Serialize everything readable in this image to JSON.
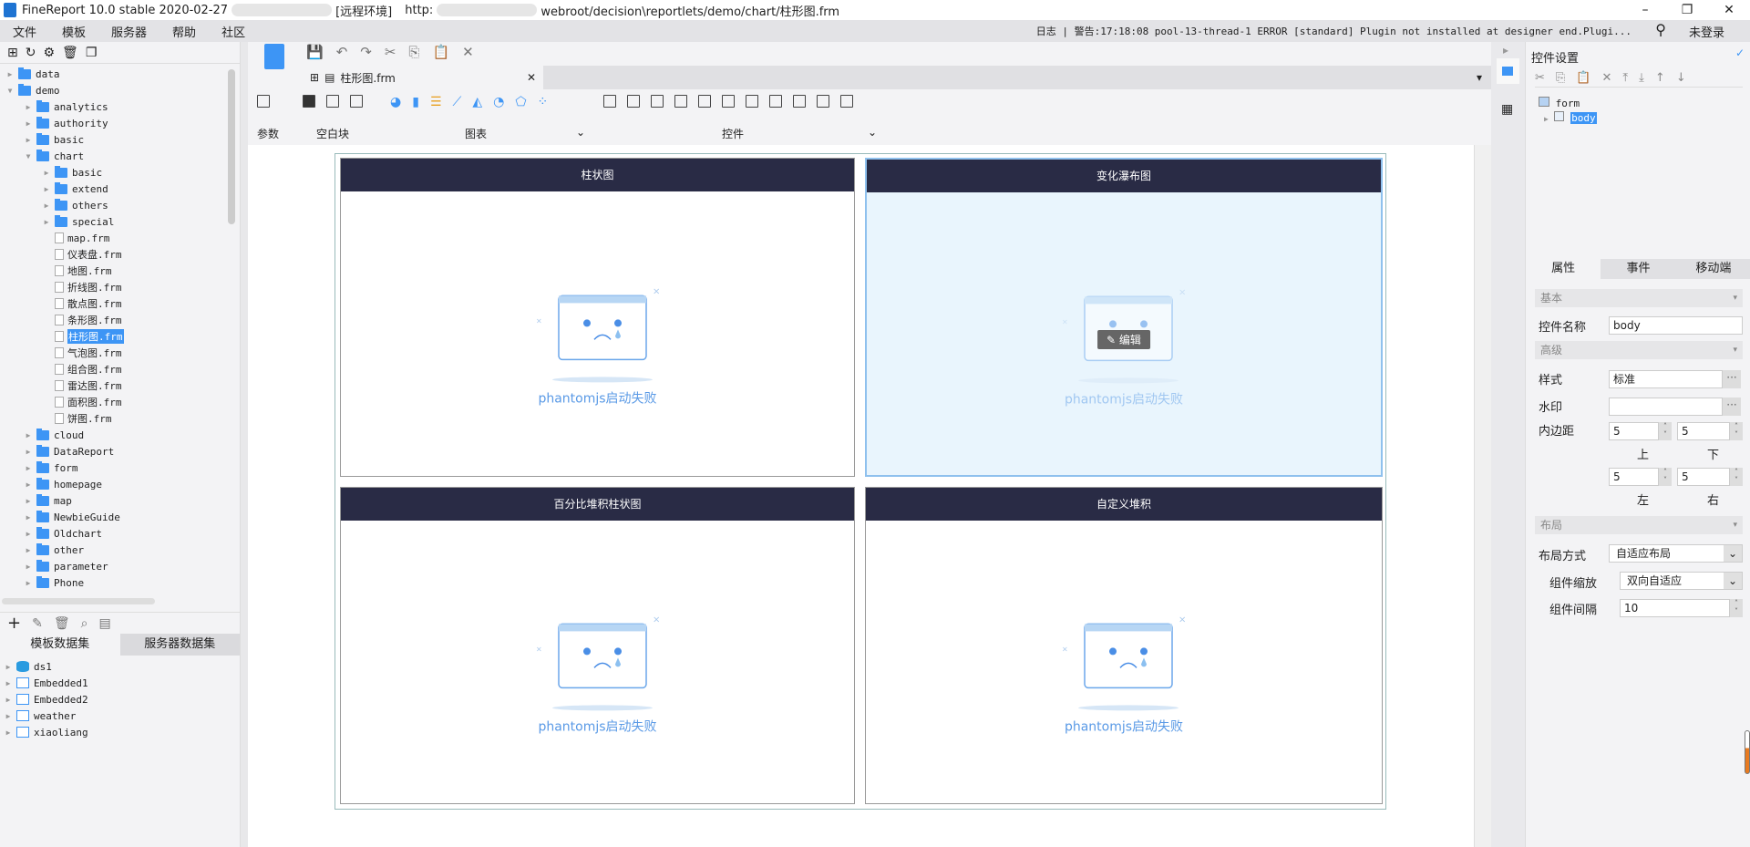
{
  "title": {
    "app": "FineReport 10.0 stable 2020-02-27",
    "env": "[远程环境]",
    "url_prefix": "http:",
    "url_suffix": "webroot/decision\\reportlets/demo/chart/柱形图.frm"
  },
  "menu": [
    "文件",
    "模板",
    "服务器",
    "帮助",
    "社区"
  ],
  "log": "日志 | 警告:17:18:08 pool-13-thread-1 ERROR [standard] Plugin not installed at designer end.Plugi...",
  "login": "未登录",
  "tree": {
    "top": [
      {
        "label": "data",
        "level": 0,
        "type": "folder",
        "exp": "▶"
      },
      {
        "label": "demo",
        "level": 0,
        "type": "folder",
        "exp": "▼"
      },
      {
        "label": "analytics",
        "level": 1,
        "type": "folder",
        "exp": "▶"
      },
      {
        "label": "authority",
        "level": 1,
        "type": "folder",
        "exp": "▶"
      },
      {
        "label": "basic",
        "level": 1,
        "type": "folder",
        "exp": "▶"
      },
      {
        "label": "chart",
        "level": 1,
        "type": "folder",
        "exp": "▼"
      },
      {
        "label": "basic",
        "level": 2,
        "type": "folder",
        "exp": "▶"
      },
      {
        "label": "extend",
        "level": 2,
        "type": "folder",
        "exp": "▶"
      },
      {
        "label": "others",
        "level": 2,
        "type": "folder",
        "exp": "▶"
      },
      {
        "label": "special",
        "level": 2,
        "type": "folder",
        "exp": "▶"
      },
      {
        "label": "map.frm",
        "level": 2,
        "type": "file"
      },
      {
        "label": "仪表盘.frm",
        "level": 2,
        "type": "file"
      },
      {
        "label": "地图.frm",
        "level": 2,
        "type": "file"
      },
      {
        "label": "折线图.frm",
        "level": 2,
        "type": "file"
      },
      {
        "label": "散点图.frm",
        "level": 2,
        "type": "file"
      },
      {
        "label": "条形图.frm",
        "level": 2,
        "type": "file"
      },
      {
        "label": "柱形图.frm",
        "level": 2,
        "type": "file",
        "selected": true
      },
      {
        "label": "气泡图.frm",
        "level": 2,
        "type": "file"
      },
      {
        "label": "组合图.frm",
        "level": 2,
        "type": "file"
      },
      {
        "label": "雷达图.frm",
        "level": 2,
        "type": "file"
      },
      {
        "label": "面积图.frm",
        "level": 2,
        "type": "file"
      },
      {
        "label": "饼图.frm",
        "level": 2,
        "type": "file"
      },
      {
        "label": "cloud",
        "level": 1,
        "type": "folder",
        "exp": "▶"
      },
      {
        "label": "DataReport",
        "level": 1,
        "type": "folder",
        "exp": "▶"
      },
      {
        "label": "form",
        "level": 1,
        "type": "folder",
        "exp": "▶"
      },
      {
        "label": "homepage",
        "level": 1,
        "type": "folder",
        "exp": "▶"
      },
      {
        "label": "map",
        "level": 1,
        "type": "folder",
        "exp": "▶"
      },
      {
        "label": "NewbieGuide",
        "level": 1,
        "type": "folder",
        "exp": "▶"
      },
      {
        "label": "Oldchart",
        "level": 1,
        "type": "folder",
        "exp": "▶"
      },
      {
        "label": "other",
        "level": 1,
        "type": "folder",
        "exp": "▶"
      },
      {
        "label": "parameter",
        "level": 1,
        "type": "folder",
        "exp": "▶"
      },
      {
        "label": "Phone",
        "level": 1,
        "type": "folder",
        "exp": "▶"
      }
    ]
  },
  "datasets": {
    "tabs": [
      "模板数据集",
      "服务器数据集"
    ],
    "items": [
      "ds1",
      "Embedded1",
      "Embedded2",
      "weather",
      "xiaoliang"
    ]
  },
  "file_tab": "柱形图.frm",
  "groups": {
    "param": "参数",
    "blank": "空白块",
    "chart": "图表",
    "widget": "控件"
  },
  "panels": [
    {
      "title": "柱状图",
      "error": "phantomjs启动失败"
    },
    {
      "title": "变化瀑布图",
      "error": "phantomjs启动失败",
      "edit": "编辑"
    },
    {
      "title": "百分比堆积柱状图",
      "error": "phantomjs启动失败"
    },
    {
      "title": "自定义堆积",
      "error": "phantomjs启动失败"
    }
  ],
  "right": {
    "title": "控件设置",
    "tree_root": "form",
    "tree_child": "body",
    "tabs": [
      "属性",
      "事件",
      "移动端"
    ],
    "sec_basic": "基本",
    "name_label": "控件名称",
    "name_value": "body",
    "sec_adv": "高级",
    "style_label": "样式",
    "style_value": "标准",
    "watermark_label": "水印",
    "watermark_value": "",
    "padding_label": "内边距",
    "pad_top": "5",
    "pad_bottom": "5",
    "pad_left": "5",
    "pad_right": "5",
    "top": "上",
    "bottom": "下",
    "left": "左",
    "right": "右",
    "sec_layout": "布局",
    "layout_label": "布局方式",
    "layout_value": "自适应布局",
    "scale_label": "组件缩放",
    "scale_value": "双向自适应",
    "gap_label": "组件间隔",
    "gap_value": "10"
  },
  "colors": {
    "accent": "#3d95f5",
    "panel_header": "#292b45",
    "error_text": "#5a9ae6"
  }
}
